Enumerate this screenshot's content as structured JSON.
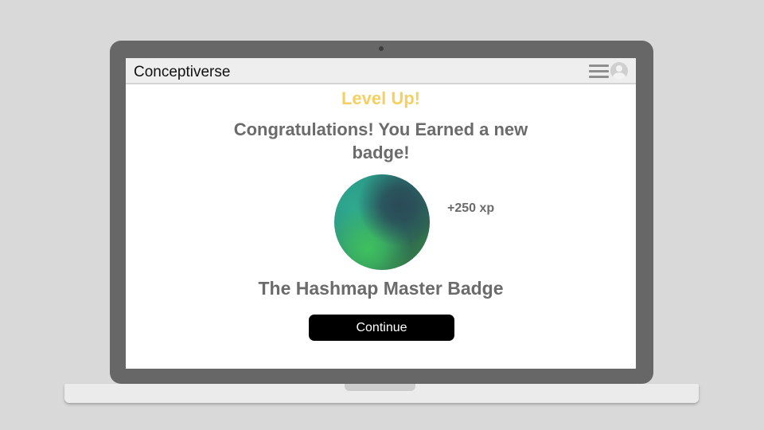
{
  "app": {
    "brand": "Conceptiverse",
    "menu_icon": "hamburger-menu-icon",
    "avatar_icon": "user-avatar-icon"
  },
  "reward": {
    "heading": "Level Up!",
    "message": "Congratulations! You Earned a new badge!",
    "xp_label": "+250 xp",
    "badge_name": "The Hashmap Master Badge",
    "continue_label": "Continue"
  },
  "colors": {
    "heading": "#f5d061",
    "text": "#6b6b6b",
    "button_bg": "#000000",
    "button_text": "#ffffff",
    "device_frame": "#676767"
  }
}
